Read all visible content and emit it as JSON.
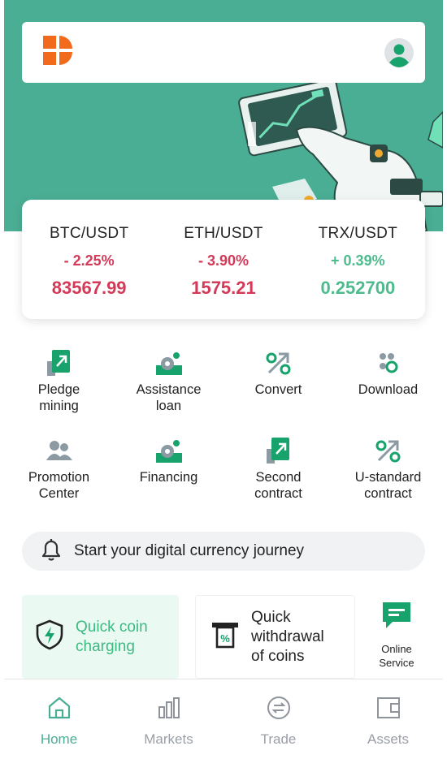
{
  "colors": {
    "brand": "#4aae94",
    "down": "#d43a58",
    "up": "#4dbb8d",
    "logo_orange": "#f26a1b"
  },
  "header": {
    "logo_icon": "logo-icon",
    "avatar_icon": "user-avatar-icon"
  },
  "tickers": [
    {
      "pair": "BTC/USDT",
      "change": "- 2.25%",
      "price": "83567.99",
      "trend": "down"
    },
    {
      "pair": "ETH/USDT",
      "change": "- 3.90%",
      "price": "1575.21",
      "trend": "down"
    },
    {
      "pair": "TRX/USDT",
      "change": "+ 0.39%",
      "price": "0.252700",
      "trend": "up"
    }
  ],
  "features": [
    {
      "label": "Pledge\nmining",
      "icon": "pledge-mining-icon"
    },
    {
      "label": "Assistance\nloan",
      "icon": "assistance-loan-icon"
    },
    {
      "label": "Convert",
      "icon": "convert-icon"
    },
    {
      "label": "Download",
      "icon": "download-icon"
    },
    {
      "label": "Promotion\nCenter",
      "icon": "promotion-center-icon"
    },
    {
      "label": "Financing",
      "icon": "financing-icon"
    },
    {
      "label": "Second\ncontract",
      "icon": "second-contract-icon"
    },
    {
      "label": "U-standard\ncontract",
      "icon": "u-standard-contract-icon"
    }
  ],
  "notice": {
    "text": "Start your digital currency journey",
    "icon": "bell-icon"
  },
  "quick": {
    "charging": {
      "label": "Quick coin\ncharging",
      "icon": "shield-lightning-icon"
    },
    "withdrawal": {
      "label": "Quick\nwithdrawal\nof coins",
      "icon": "atm-percent-icon"
    },
    "online": {
      "label": "Online\nService",
      "icon": "chat-icon"
    }
  },
  "tabs": [
    {
      "label": "Home",
      "icon": "home-icon",
      "active": true
    },
    {
      "label": "Markets",
      "icon": "bar-chart-icon",
      "active": false
    },
    {
      "label": "Trade",
      "icon": "exchange-icon",
      "active": false
    },
    {
      "label": "Assets",
      "icon": "wallet-icon",
      "active": false
    }
  ]
}
